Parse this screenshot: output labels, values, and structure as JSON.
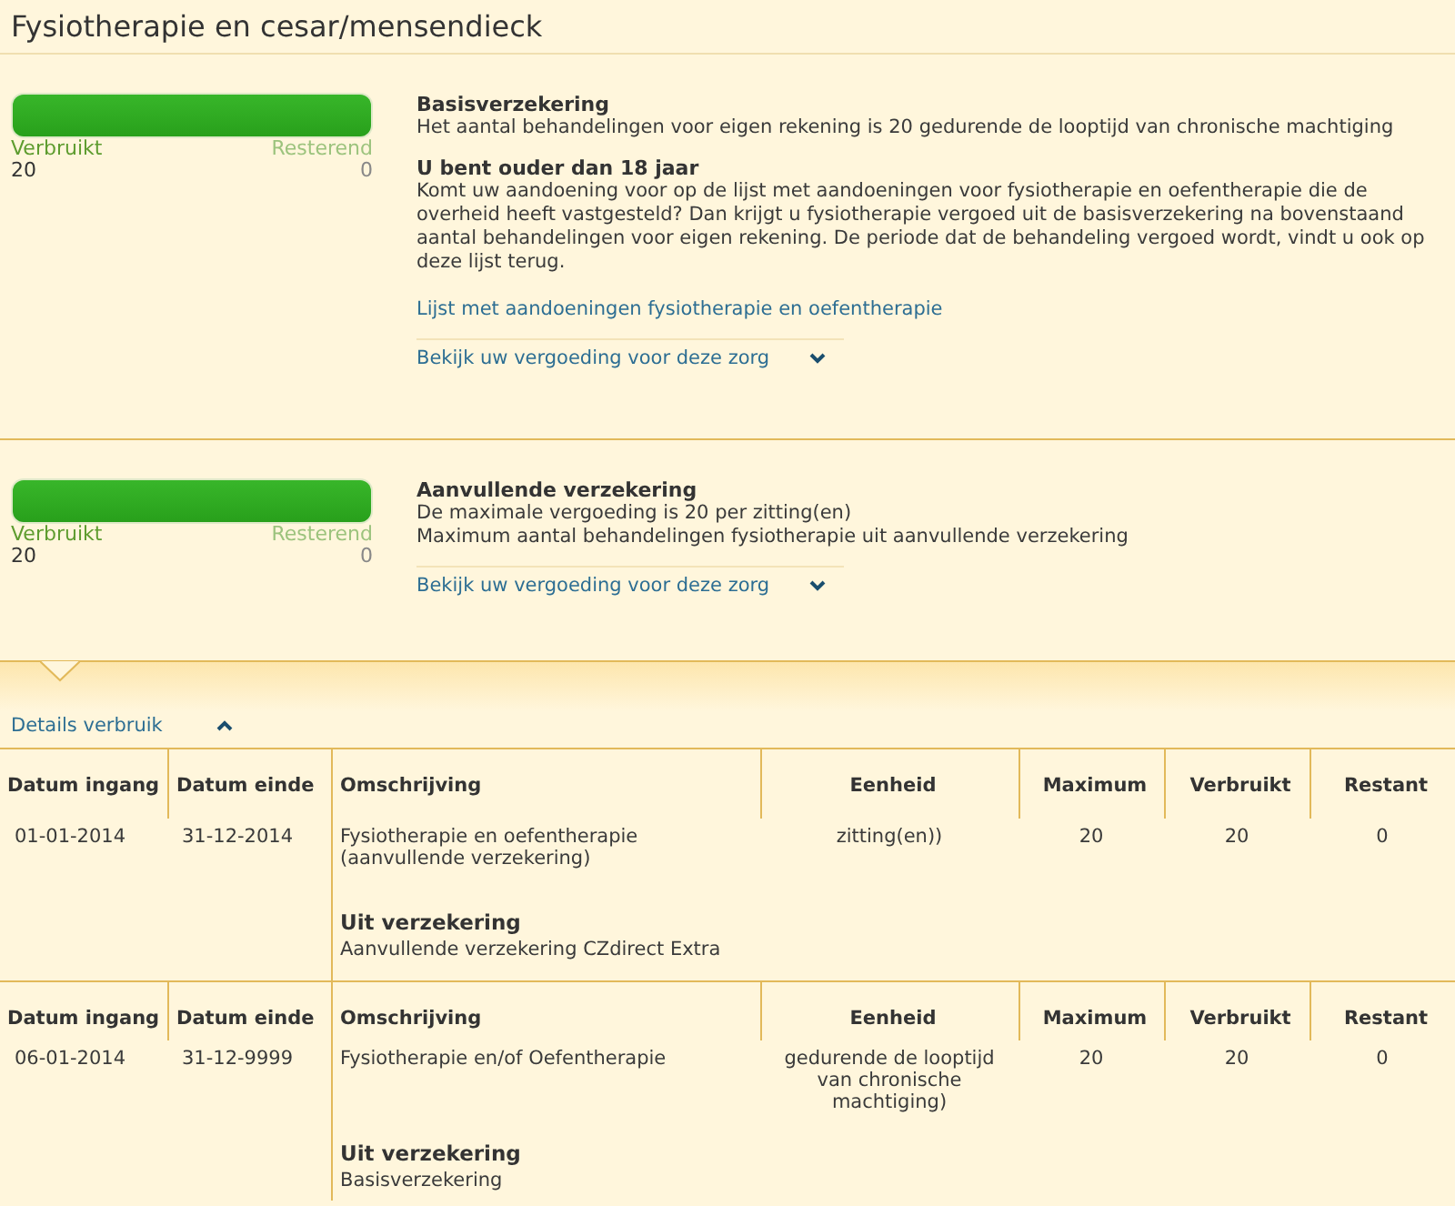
{
  "title": "Fysiotherapie en cesar/mensendieck",
  "coverage_sections": [
    {
      "meter": {
        "level": 1,
        "used_label": "Verbruikt",
        "used_value": "20",
        "remaining_label": "Resterend",
        "remaining_value": "0"
      },
      "blocks": [
        {
          "heading": "Basisverzekering",
          "lines": [
            "Het aantal behandelingen voor eigen rekening is 20 gedurende de looptijd van chronische machtiging"
          ]
        },
        {
          "heading": "U bent ouder dan 18 jaar",
          "lines": [
            "Komt uw aandoening voor op de lijst met aandoeningen voor fysiotherapie en oefentherapie die de overheid heeft vastgesteld? Dan krijgt u fysiotherapie vergoed uit de basisverzekering na bovenstaand aantal behandelingen voor eigen rekening. De periode dat de behandeling vergoed wordt, vindt u ook op deze lijst terug."
          ]
        }
      ],
      "link": "Lijst met aandoeningen fysiotherapie en oefentherapie",
      "toggle": {
        "label": "Bekijk uw vergoeding voor deze zorg",
        "expanded": false
      }
    },
    {
      "meter": {
        "level": 1,
        "used_label": "Verbruikt",
        "used_value": "20",
        "remaining_label": "Resterend",
        "remaining_value": "0"
      },
      "blocks": [
        {
          "heading": "Aanvullende verzekering",
          "lines": [
            "De maximale vergoeding is 20 per zitting(en)",
            "Maximum aantal behandelingen fysiotherapie uit aanvullende verzekering"
          ]
        }
      ],
      "toggle": {
        "label": "Bekijk uw vergoeding voor deze zorg",
        "expanded": false
      }
    }
  ],
  "details": {
    "toggle": {
      "label": "Details verbruik",
      "expanded": true
    },
    "tables": [
      {
        "columns": [
          "Datum ingang",
          "Datum einde",
          "Omschrijving",
          "Eenheid",
          "Maximum",
          "Verbruikt",
          "Restant"
        ],
        "row": {
          "date_start": "01-01-2014",
          "date_end": "31-12-2014",
          "description": [
            "Fysiotherapie en oefentherapie",
            "(aanvullende verzekering)"
          ],
          "unit": "zitting(en))",
          "maximum": "20",
          "used": "20",
          "remaining": "0"
        },
        "source_heading": "Uit verzekering",
        "source": "Aanvullende verzekering CZdirect Extra"
      },
      {
        "columns": [
          "Datum ingang",
          "Datum einde",
          "Omschrijving",
          "Eenheid",
          "Maximum",
          "Verbruikt",
          "Restant"
        ],
        "row": {
          "date_start": "06-01-2014",
          "date_end": "31-12-9999",
          "description": [
            "Fysiotherapie en/of Oefentherapie"
          ],
          "unit": "gedurende de looptijd van chronische machtiging)",
          "maximum": "20",
          "used": "20",
          "remaining": "0"
        },
        "source_heading": "Uit verzekering",
        "source": "Basisverzekering"
      }
    ]
  }
}
